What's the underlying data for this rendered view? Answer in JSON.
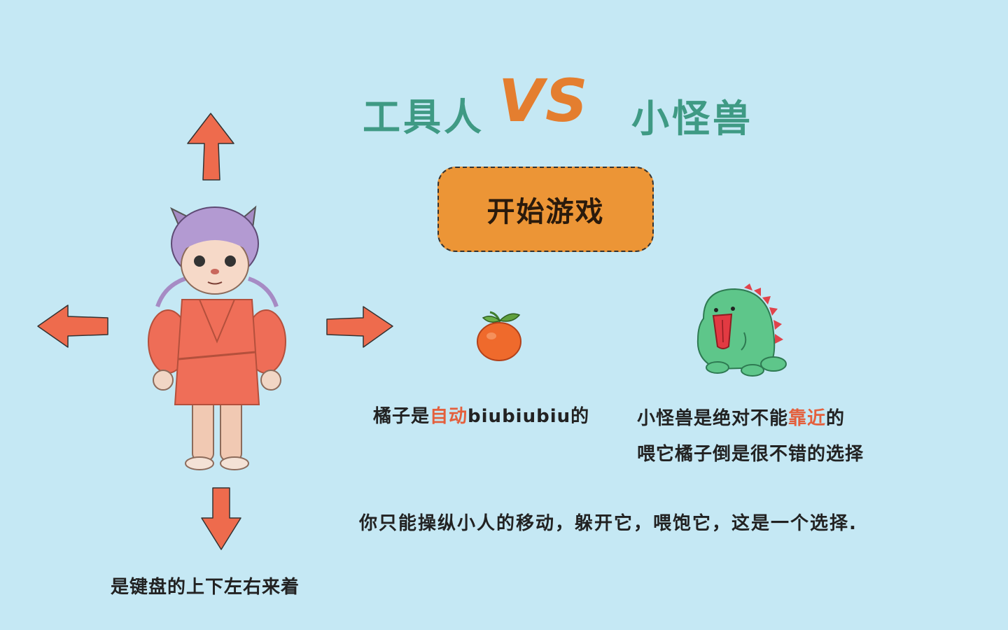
{
  "title": {
    "left": "工具人",
    "vs": "VS",
    "right": "小怪兽"
  },
  "start_button": "开始游戏",
  "orange_text": {
    "prefix": "橘子是",
    "highlight": "自动",
    "suffix": "biubiubiu的"
  },
  "monster_text": {
    "line1_prefix": "小怪兽是绝对不能",
    "line1_highlight": "靠近",
    "line1_suffix": "的",
    "line2": "喂它橘子倒是很不错的选择"
  },
  "instruction": "你只能操纵小人的移动，躲开它，喂饱它，这是一个选择.",
  "controls_text": "是键盘的上下左右来着",
  "colors": {
    "background": "#c5e8f4",
    "title_green": "#3f9a84",
    "vs_orange": "#e47e2f",
    "arrow": "#ee6b4d",
    "button": "#ec9536",
    "highlight": "#e45f3c"
  }
}
